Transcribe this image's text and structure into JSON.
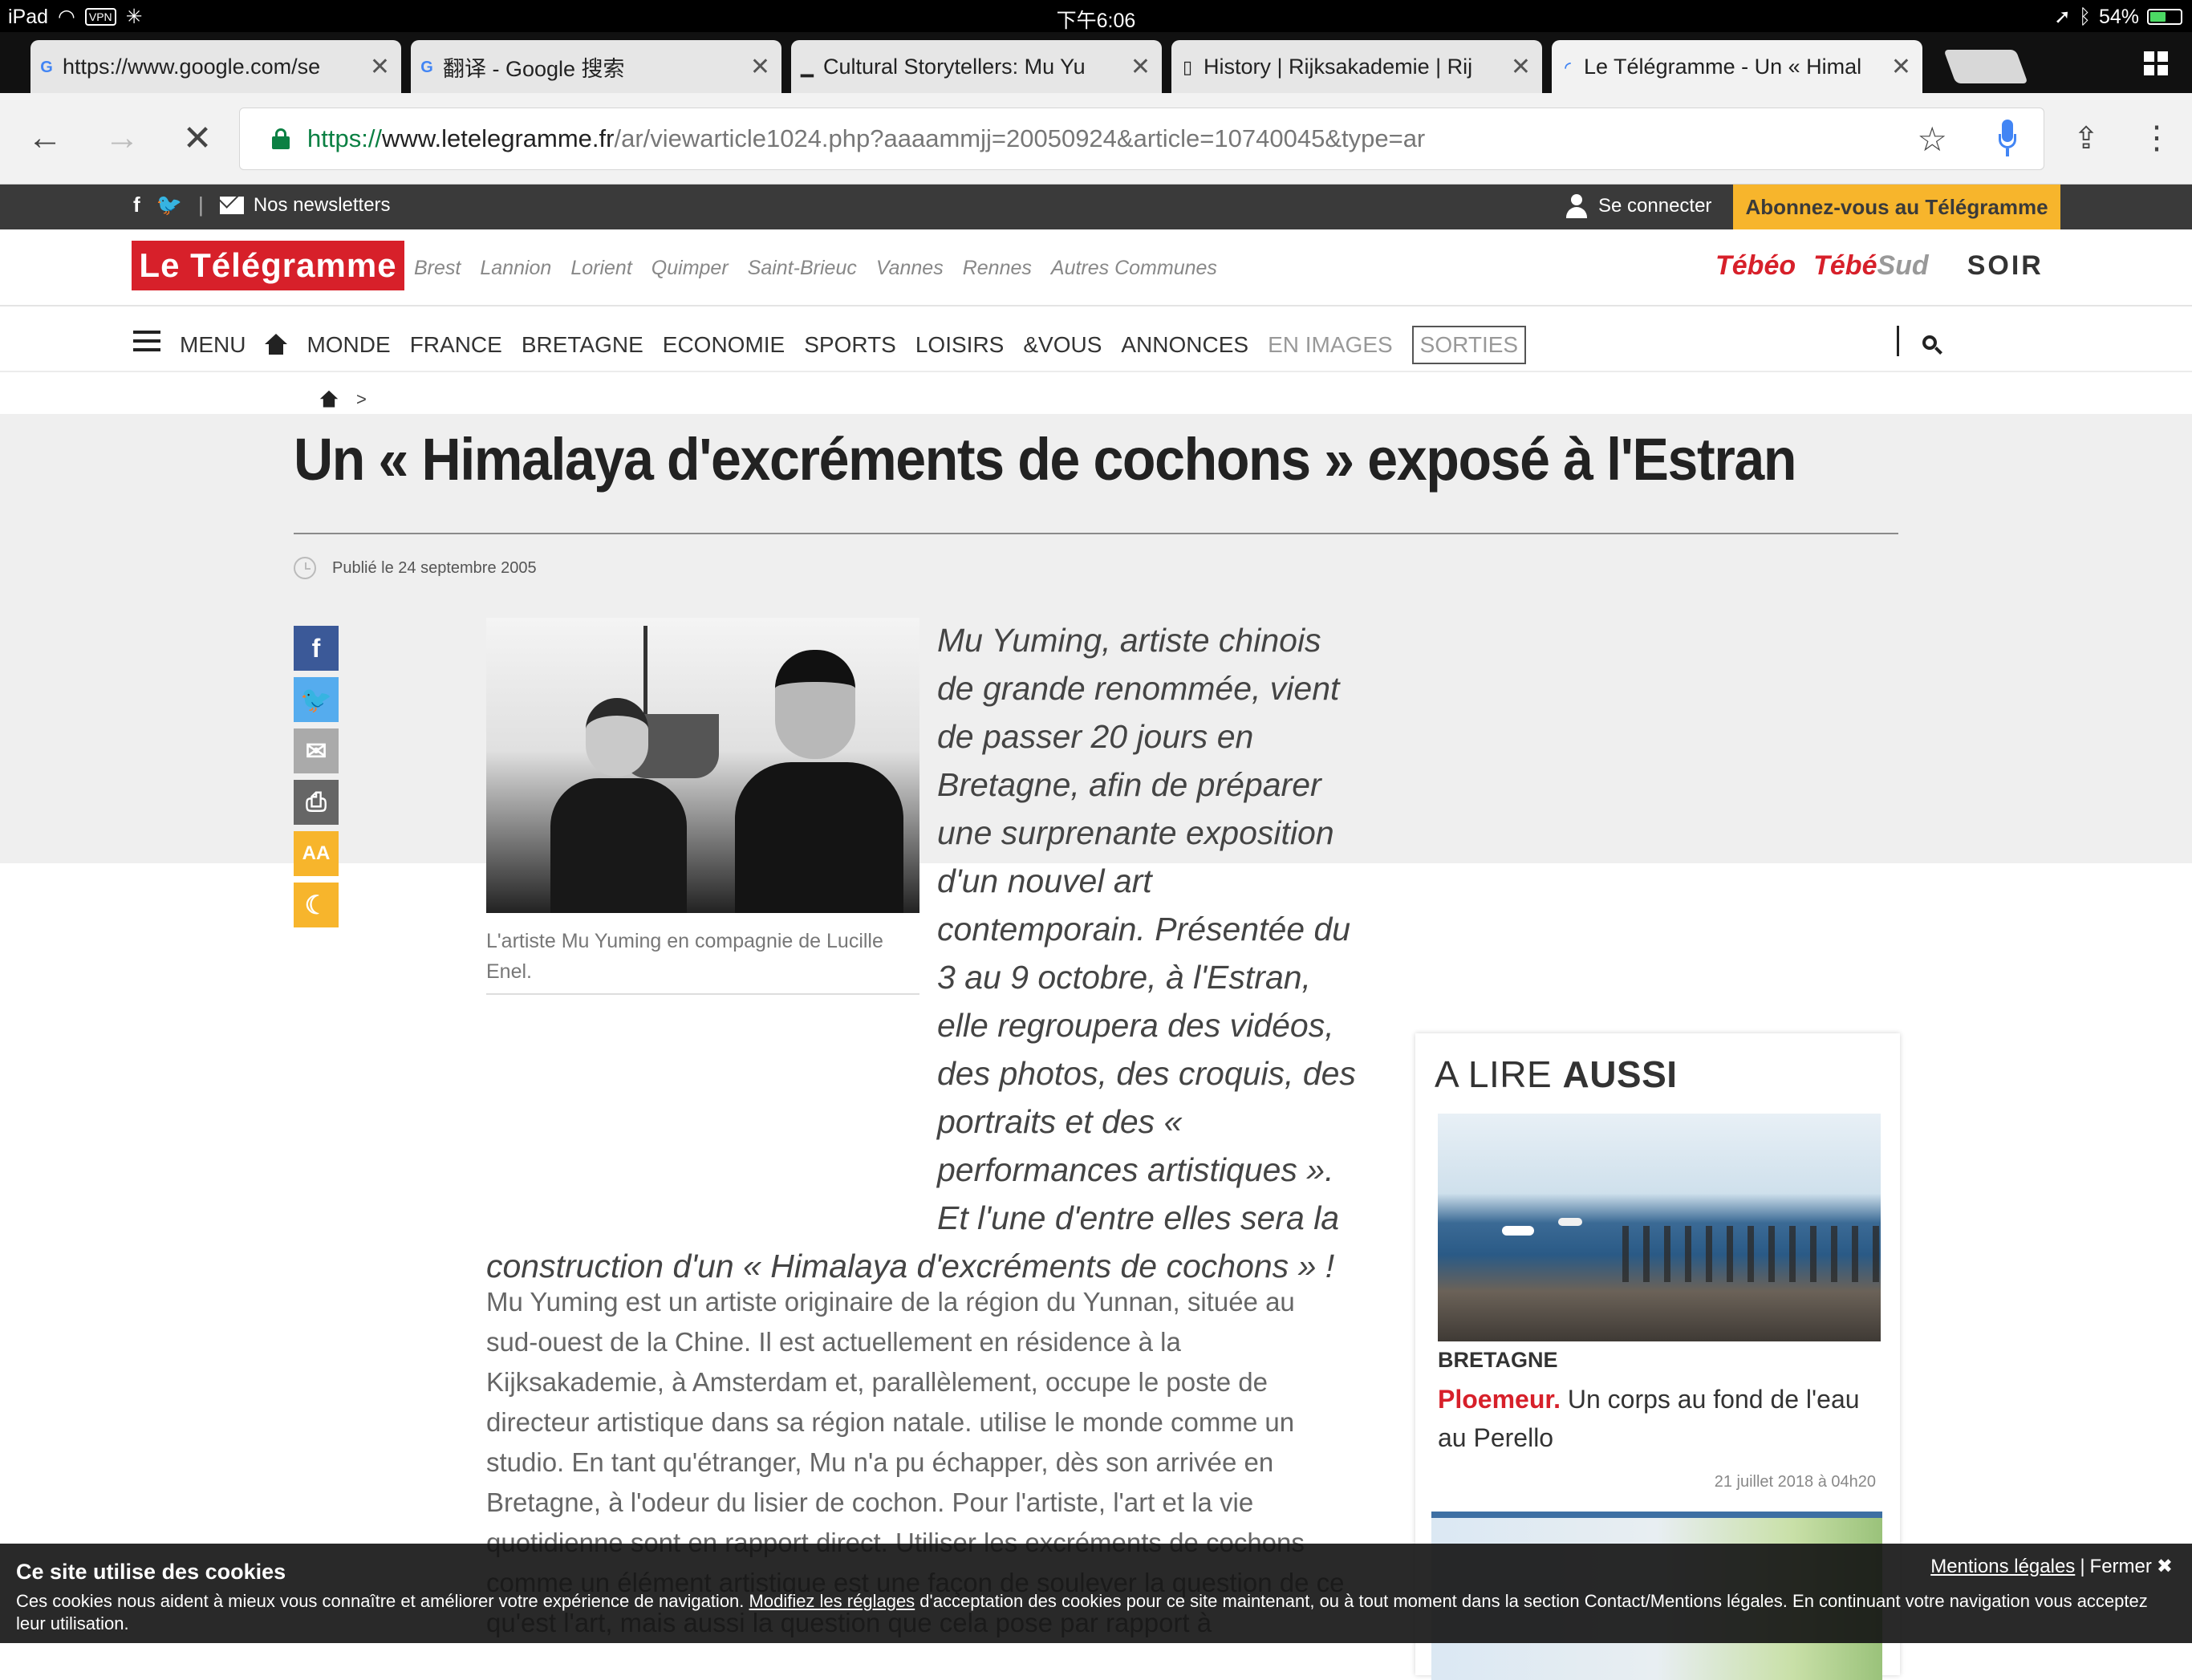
{
  "status_bar": {
    "device": "iPad",
    "vpn": "VPN",
    "time": "下午6:06",
    "battery": "54%",
    "battery_level": 0.54
  },
  "tabs": [
    {
      "title": "https://www.google.com/se",
      "favicon": "google-g-icon",
      "active": false
    },
    {
      "title": "翻译 - Google 搜索",
      "favicon": "google-g-icon",
      "active": false
    },
    {
      "title": "Cultural Storytellers: Mu Yu",
      "favicon": "blank-page-icon",
      "active": false
    },
    {
      "title": "History | Rijksakademie | Rij",
      "favicon": "document-icon",
      "active": false
    },
    {
      "title": "Le Télégramme - Un « Himal",
      "favicon": "loading-spinner-icon",
      "active": true
    }
  ],
  "address_bar": {
    "scheme": "https://",
    "host": "www.letelegramme.fr",
    "path": "/ar/viewarticle1024.php?aaaammjj=20050924&article=10740045&type=ar"
  },
  "site_top": {
    "newsletters": "Nos newsletters",
    "login": "Se connecter",
    "subscribe": "Abonnez-vous au Télégramme"
  },
  "brand": {
    "logo": "Le Télégramme",
    "cities": [
      "Brest",
      "Lannion",
      "Lorient",
      "Quimper",
      "Saint-Brieuc",
      "Vannes",
      "Rennes",
      "Autres Communes"
    ],
    "partner_tebeo": "Tébéo",
    "partner_tebesud_a": "Tébé",
    "partner_tebesud_b": "Sud",
    "partner_soir": "SOIR"
  },
  "nav": {
    "menu": "MENU",
    "items": [
      "MONDE",
      "FRANCE",
      "BRETAGNE",
      "ECONOMIE",
      "SPORTS",
      "LOISIRS",
      "&VOUS",
      "ANNONCES"
    ],
    "muted": "EN IMAGES",
    "boxed": "SORTIES"
  },
  "article": {
    "breadcrumb_sep": ">",
    "title": "Un « Himalaya d'excréments de cochons » exposé à l'Estran",
    "published": "Publié le 24 septembre 2005",
    "photo_caption": "L'artiste Mu Yuming en compagnie de Lucille Enel.",
    "lead": "Mu Yuming, artiste chinois de grande renommée, vient de passer 20 jours en Bretagne, afin de préparer une surprenante exposition d'un nouvel art contemporain. Présentée du 3 au 9 octobre, à l'Estran, elle regroupera des vidéos, des photos, des croquis, des portraits et des « performances artistiques ». Et l'une d'entre elles sera la construction d'un « Himalaya d'excréments de cochons » !",
    "body": "Mu Yuming est un artiste originaire de la région du Yunnan, située au sud-ouest de la Chine. Il est actuellement en résidence à la Kijksakademie, à Amsterdam et, parallèlement, occupe le poste de directeur artistique dans sa région natale. utilise le monde comme un studio. En tant qu'étranger, Mu n'a pu échapper, dès son arrivée en Bretagne, à l'odeur du lisier de cochon. Pour l'artiste, l'art et la vie quotidienne sont en rapport direct. Utiliser les excréments de cochons comme un élément artistique est une façon de soulever la question de ce qu'est l'art, mais aussi la question que cela pose par rapport à"
  },
  "share": {
    "font_size_label": "AA"
  },
  "aside": {
    "title_light": "A LIRE ",
    "title_bold": "AUSSI",
    "category": "BRETAGNE",
    "headline_place": "Ploemeur.",
    "headline_rest": " Un corps au fond de l'eau au Perello",
    "date": "21 juillet 2018 à 04h20"
  },
  "cookie": {
    "title": "Ce site utilise des cookies",
    "text_a": "Ces cookies nous aident à mieux vous connaître et améliorer votre expérience de navigation. ",
    "link": "Modifiez les réglages",
    "text_b": " d'acceptation des cookies pour ce site maintenant, ou à tout moment dans la section Contact/Mentions légales. En continuant votre navigation vous acceptez leur utilisation.",
    "legal": "Mentions légales",
    "separator": "|",
    "close": "Fermer"
  },
  "colors": {
    "brand_red": "#d7202a",
    "subscribe_yellow": "#f7b52c",
    "facebook_blue": "#3b5998",
    "twitter_blue": "#55acee"
  }
}
